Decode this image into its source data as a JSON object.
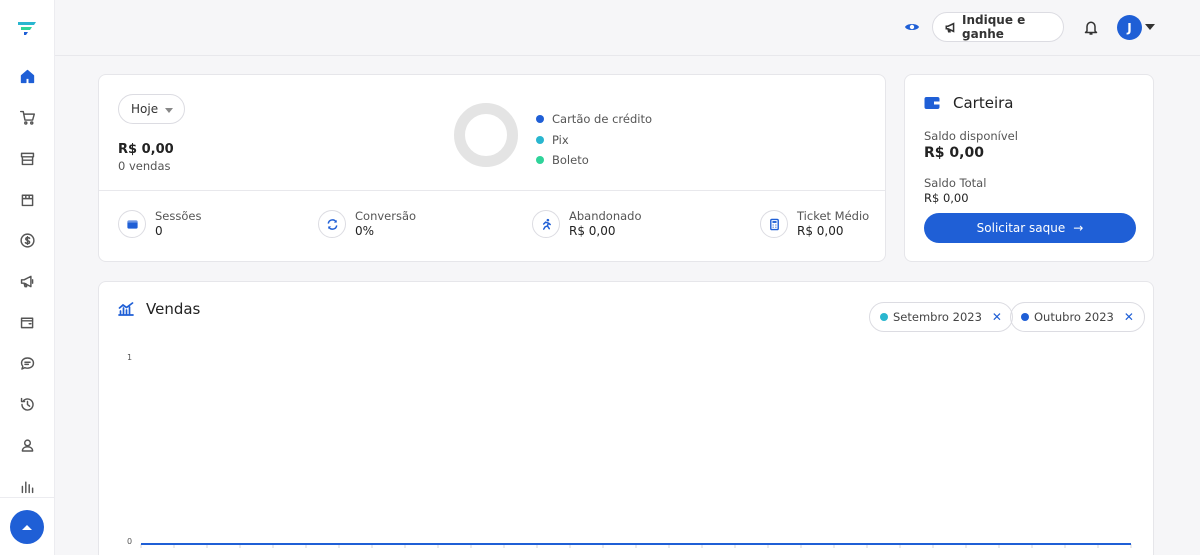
{
  "topbar": {
    "referral_label": "Indique e ganhe",
    "avatar_initial": "J"
  },
  "summary": {
    "period": "Hoje",
    "total_value": "R$ 0,00",
    "total_count": "0 vendas",
    "payment_legend": [
      {
        "label": "Cartão de crédito",
        "color": "#1f5fd6"
      },
      {
        "label": "Pix",
        "color": "#29b6cf"
      },
      {
        "label": "Boleto",
        "color": "#2fd39a"
      }
    ],
    "stats": [
      {
        "label": "Sessões",
        "value": "0",
        "icon": "window-icon"
      },
      {
        "label": "Conversão",
        "value": "0%",
        "icon": "refresh-icon"
      },
      {
        "label": "Abandonado",
        "value": "R$ 0,00",
        "icon": "running-person-icon"
      },
      {
        "label": "Ticket Médio",
        "value": "R$ 0,00",
        "icon": "calculator-icon"
      }
    ]
  },
  "wallet": {
    "title": "Carteira",
    "available_label": "Saldo disponível",
    "available_value": "R$ 0,00",
    "total_label": "Saldo Total",
    "total_value": "R$ 0,00",
    "withdraw_label": "Solicitar saque"
  },
  "sales": {
    "title": "Vendas",
    "filters": [
      {
        "label": "Setembro 2023",
        "color": "#29b6cf"
      },
      {
        "label": "Outubro 2023",
        "color": "#1f5fd6"
      }
    ]
  },
  "chart_data": {
    "type": "line",
    "title": "Vendas",
    "ylim": [
      0,
      1
    ],
    "yticks": [
      "1",
      "0"
    ],
    "series": [
      {
        "name": "Setembro 2023",
        "color": "#29b6cf",
        "values": [
          0,
          0,
          0,
          0,
          0,
          0,
          0,
          0,
          0,
          0,
          0,
          0,
          0,
          0,
          0,
          0,
          0,
          0,
          0,
          0,
          0,
          0,
          0,
          0,
          0,
          0,
          0,
          0,
          0,
          0,
          0
        ]
      },
      {
        "name": "Outubro 2023",
        "color": "#1f5fd6",
        "values": [
          0,
          0,
          0,
          0,
          0,
          0,
          0,
          0,
          0,
          0,
          0,
          0,
          0,
          0,
          0,
          0,
          0,
          0,
          0,
          0,
          0,
          0,
          0,
          0,
          0,
          0,
          0,
          0,
          0,
          0,
          0
        ]
      }
    ],
    "grid": false
  }
}
